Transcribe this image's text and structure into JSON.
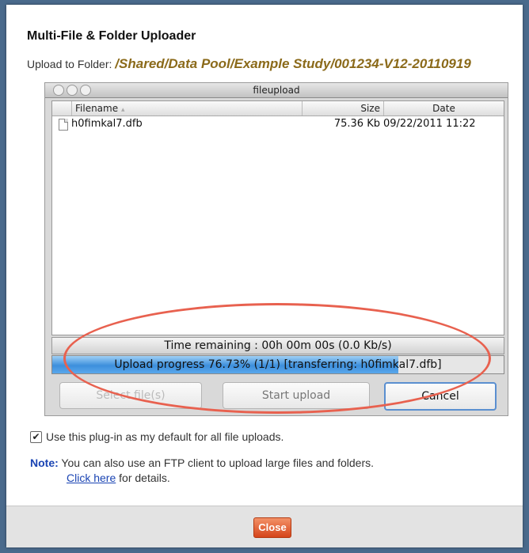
{
  "dialog": {
    "title": "Multi-File & Folder Uploader",
    "upload_to_label": "Upload to Folder:",
    "upload_to_path": "/Shared/Data Pool/Example Study/001234-V12-20110919"
  },
  "applet": {
    "window_title": "fileupload",
    "columns": [
      "Filename",
      "Size",
      "Date"
    ],
    "files": [
      {
        "name": "h0fimkal7.dfb",
        "size": "75.36 Kb",
        "date": "09/22/2011 11:22"
      }
    ],
    "time_remaining": "Time remaining : 00h 00m 00s (0.0 Kb/s)",
    "progress_text": "Upload progress 76.73% (1/1) [transferring: h0fimkal7.dfb]",
    "progress_percent": 76.73,
    "buttons": {
      "select": "Select file(s)",
      "start": "Start upload",
      "cancel": "Cancel"
    }
  },
  "default_option": {
    "checked": true,
    "label": "Use this plug-in as my default for all file uploads."
  },
  "note": {
    "label": "Note:",
    "text": "You can also use an FTP client to upload large files and folders.",
    "link": "Click here",
    "link_suffix": "for details."
  },
  "footer": {
    "close_label": "Close"
  },
  "colors": {
    "annotation_oval": "#e8614f",
    "path_text": "#8b6a1a",
    "note_blue": "#1a44b3",
    "close_button": "#d5441a",
    "progress_fill": "#3d8fdc"
  }
}
